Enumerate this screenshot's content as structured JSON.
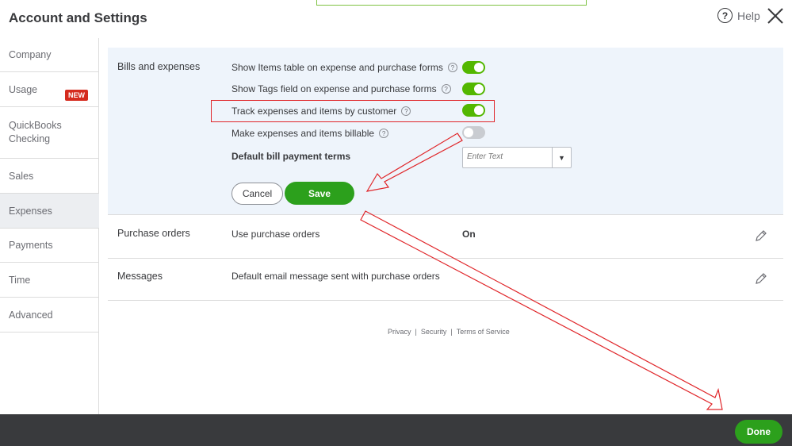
{
  "header": {
    "title": "Account and Settings",
    "help_icon_glyph": "?",
    "help_label": "Help",
    "close_icon": "close-icon"
  },
  "sidebar": {
    "items": [
      {
        "label": "Company"
      },
      {
        "label": "Usage"
      },
      {
        "label": "QuickBooks Checking",
        "badge": "NEW"
      },
      {
        "label": "Sales"
      },
      {
        "label": "Expenses",
        "active": true
      },
      {
        "label": "Payments"
      },
      {
        "label": "Time"
      },
      {
        "label": "Advanced"
      }
    ],
    "checking_line1": "QuickBooks",
    "checking_line2": "Checking"
  },
  "bills": {
    "label": "Bills and expenses",
    "options": [
      {
        "label": "Show Items table on expense and purchase forms",
        "on": true
      },
      {
        "label": "Show Tags field on expense and purchase forms",
        "on": true
      },
      {
        "label": "Track expenses and items by customer",
        "on": true,
        "highlighted": true
      },
      {
        "label": "Make expenses and items billable",
        "on": false
      }
    ],
    "help_glyph": "?",
    "bill_terms_label": "Default bill payment terms",
    "bill_terms_placeholder": "Enter Text",
    "dropdown_arrow": "▼",
    "cancel_label": "Cancel",
    "save_label": "Save"
  },
  "purchase_orders": {
    "label": "Purchase orders",
    "setting": "Use purchase orders",
    "value": "On"
  },
  "messages": {
    "label": "Messages",
    "setting": "Default email message sent with purchase orders"
  },
  "footer": {
    "links": [
      "Privacy",
      "Security",
      "Terms of Service"
    ],
    "separator": "|"
  },
  "bottom_bar": {
    "done_label": "Done"
  },
  "colors": {
    "toggle_on": "#53b700",
    "primary_button": "#2ca01c",
    "annotation": "#e0262a",
    "bottom_bar": "#393a3d"
  }
}
